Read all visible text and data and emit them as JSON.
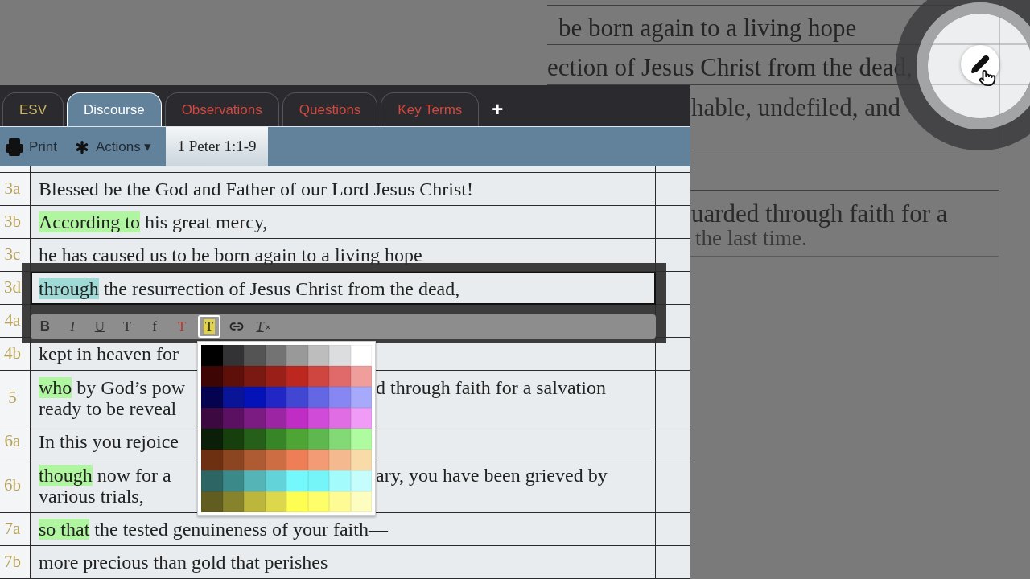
{
  "background_zoom": {
    "lines": [
      "be born again to a living hope",
      "ection of Jesus Christ from the dead,",
      "hable, undefiled, and",
      "uarded through faith for a",
      "the last time."
    ]
  },
  "tabs": [
    {
      "label": "ESV",
      "selected": false,
      "color": "#c9b466"
    },
    {
      "label": "Discourse",
      "selected": true,
      "color": "#ffffff"
    },
    {
      "label": "Observations",
      "selected": false,
      "color": "#d4483e"
    },
    {
      "label": "Questions",
      "selected": false,
      "color": "#d4483e"
    },
    {
      "label": "Key Terms",
      "selected": false,
      "color": "#d4483e"
    }
  ],
  "add_tab": "+",
  "toolbar": {
    "print": "Print",
    "actions": "Actions ▾",
    "passage_tab": {
      "label": "1 Peter 1:1-9",
      "selected": true
    }
  },
  "rows": [
    {
      "label": "3a",
      "lines": [
        {
          "left": [
            {
              "text": "Blessed be the God and Father of our Lord Jesus Christ!"
            }
          ]
        }
      ]
    },
    {
      "label": "3b",
      "lines": [
        {
          "left": [
            {
              "text": "According to",
              "color": "#b0f5a0"
            },
            {
              "text": " his great mercy,"
            }
          ]
        }
      ]
    },
    {
      "label": "3c",
      "lines": [
        {
          "left": [
            {
              "text": "he has caused us to be born again to a living hope"
            }
          ]
        }
      ]
    },
    {
      "label": "3d"
    },
    {
      "label": "4a"
    },
    {
      "label": "4b",
      "lines": [
        {
          "left": [
            {
              "text": "kept in heaven for"
            }
          ]
        }
      ]
    },
    {
      "label": "5",
      "lines": [
        {
          "left": [
            {
              "text": "who",
              "color": "#b0f5a0"
            },
            {
              "text": " by God’s pow"
            }
          ],
          "right": "d through faith for a salvation"
        },
        {
          "left": [
            {
              "text": "ready to be reveal"
            }
          ]
        }
      ]
    },
    {
      "label": "6a",
      "lines": [
        {
          "left": [
            {
              "text": "In this you rejoice"
            }
          ]
        }
      ]
    },
    {
      "label": "6b",
      "lines": [
        {
          "left": [
            {
              "text": "though",
              "color": "#b0f5a0"
            },
            {
              "text": " now for a"
            }
          ],
          "right": "ary, you have been grieved by"
        },
        {
          "left": [
            {
              "text": "various trials,"
            }
          ]
        }
      ]
    },
    {
      "label": "7a",
      "lines": [
        {
          "left": [
            {
              "text": "so that",
              "color": "#b0f5a0"
            },
            {
              "text": " the tested genuineness of your faith—"
            }
          ]
        }
      ]
    },
    {
      "label": "7b",
      "lines": [
        {
          "left": [
            {
              "text": "more precious than gold that perishes"
            }
          ]
        }
      ]
    }
  ],
  "editor": {
    "segments": [
      {
        "text": "through",
        "color": "#9fdad6"
      },
      {
        "text": " the resurrection of Jesus Christ from the dead,"
      }
    ],
    "tools": [
      {
        "kind": "bold",
        "label": "B",
        "selected": false
      },
      {
        "kind": "italic",
        "label": "I",
        "selected": false
      },
      {
        "kind": "underline",
        "label": "U",
        "selected": false
      },
      {
        "kind": "strike",
        "label": "T",
        "selected": false
      },
      {
        "kind": "font",
        "label": "f",
        "selected": false
      },
      {
        "kind": "color",
        "label": "T",
        "selected": false
      },
      {
        "kind": "highlight",
        "label": "T",
        "selected": true
      },
      {
        "kind": "link",
        "selected": false
      },
      {
        "kind": "clear",
        "label": "T",
        "selected": false
      }
    ],
    "palette": [
      [
        {
          "color": "#000000"
        },
        {
          "color": "#333335"
        },
        {
          "color": "#545454"
        },
        {
          "color": "#737373"
        },
        {
          "color": "#999999"
        },
        {
          "color": "#bdbdbd"
        },
        {
          "color": "#dcdddf"
        },
        {
          "color": "#ffffff"
        }
      ],
      [
        {
          "color": "#3d0604"
        },
        {
          "color": "#5e0f0a"
        },
        {
          "color": "#7a1812"
        },
        {
          "color": "#9a1f18"
        },
        {
          "color": "#bc281f"
        },
        {
          "color": "#cf4540"
        },
        {
          "color": "#e06a6a"
        },
        {
          "color": "#f09e9c"
        }
      ],
      [
        {
          "color": "#03034f"
        },
        {
          "color": "#0a1497"
        },
        {
          "color": "#0413b8"
        },
        {
          "color": "#2127c5"
        },
        {
          "color": "#4247d3"
        },
        {
          "color": "#6367e3"
        },
        {
          "color": "#8787f3"
        },
        {
          "color": "#a7a9fa"
        }
      ],
      [
        {
          "color": "#3c0a40"
        },
        {
          "color": "#5c1062"
        },
        {
          "color": "#7a1c81"
        },
        {
          "color": "#9b25a2"
        },
        {
          "color": "#bf2dc4"
        },
        {
          "color": "#d14bd9"
        },
        {
          "color": "#e16de4"
        },
        {
          "color": "#f09cf6"
        }
      ],
      [
        {
          "color": "#0b1e07"
        },
        {
          "color": "#173f0e"
        },
        {
          "color": "#265f1a"
        },
        {
          "color": "#388528"
        },
        {
          "color": "#4ea536"
        },
        {
          "color": "#5eb84f"
        },
        {
          "color": "#84d977"
        },
        {
          "color": "#affb9f"
        }
      ],
      [
        {
          "color": "#6d3011"
        },
        {
          "color": "#8b4520"
        },
        {
          "color": "#ae5a32"
        },
        {
          "color": "#cc6d43"
        },
        {
          "color": "#ee7e56"
        },
        {
          "color": "#f29b74"
        },
        {
          "color": "#f5b98f"
        },
        {
          "color": "#f9dbaa"
        }
      ],
      [
        {
          "color": "#2d6564"
        },
        {
          "color": "#3b8a89"
        },
        {
          "color": "#55b5b6"
        },
        {
          "color": "#62d4d9"
        },
        {
          "color": "#75f8fb"
        },
        {
          "color": "#75f5f8"
        },
        {
          "color": "#a4fbfb"
        },
        {
          "color": "#c5fcfc"
        }
      ],
      [
        {
          "color": "#615c20"
        },
        {
          "color": "#87832d"
        },
        {
          "color": "#bcb63c"
        },
        {
          "color": "#ddd84b"
        },
        {
          "color": "#fefe52"
        },
        {
          "color": "#fefe6a"
        },
        {
          "color": "#fefb94"
        },
        {
          "color": "#fefdc0"
        }
      ]
    ]
  }
}
